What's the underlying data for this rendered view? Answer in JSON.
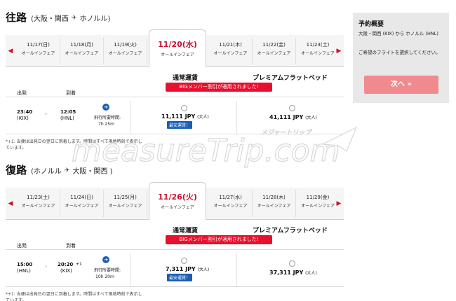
{
  "outbound": {
    "title": "往路",
    "from": "(大阪・関西",
    "to": "ホノルル)",
    "dates": [
      {
        "date": "11/17(日)",
        "sub": "オールインフェア"
      },
      {
        "date": "11/18(月)",
        "sub": "オールインフェア"
      },
      {
        "date": "11/19(火)",
        "sub": "オールインフェア"
      },
      {
        "date": "11/20(水)",
        "sub": "オールインフェア"
      },
      {
        "date": "11/21(木)",
        "sub": "オールインフェア"
      },
      {
        "date": "11/22(金)",
        "sub": "オールインフェア"
      },
      {
        "date": "11/23(土)",
        "sub": "オールインフェア"
      }
    ],
    "fare_regular": "通常運賃",
    "fare_premium": "プレミアムフラットベッド",
    "banner": "BIGメンバー割引が適用されました!",
    "label_depart": "出発",
    "label_arrive": "到着",
    "flight": {
      "dep_time": "23:40",
      "dep_code": "(KIX)",
      "arr_time": "12:05",
      "arr_code": "(HNL)",
      "duration_label": "飛行所要時間:",
      "duration": "7h 25m",
      "regular_price": "11,111 JPY",
      "regular_unit": "(大人)",
      "cheapest": "最安運賃！",
      "premium_price": "41,111 JPY",
      "premium_unit": "(大人)"
    },
    "note": "*+1: 当便は出発日の翌日に到着します。時間はすべて現地時刻で表示しています。"
  },
  "return": {
    "title": "復路",
    "from": "(ホノルル",
    "to": "大阪・関西 )",
    "dates": [
      {
        "date": "11/23(土)",
        "sub": "オールインフェア"
      },
      {
        "date": "11/24(日)",
        "sub": "オールインフェア"
      },
      {
        "date": "11/25(月)",
        "sub": "オールインフェア"
      },
      {
        "date": "11/26(火)",
        "sub": "オールインフェア"
      },
      {
        "date": "11/27(水)",
        "sub": "オールインフェア"
      },
      {
        "date": "11/28(木)",
        "sub": "オールインフェア"
      },
      {
        "date": "11/29(金)",
        "sub": "オールインフェア"
      }
    ],
    "fare_regular": "通常運賃",
    "fare_premium": "プレミアムフラットベッド",
    "banner": "BIGメンバー割引が適用されました!",
    "label_depart": "出発",
    "label_arrive": "到着",
    "flight": {
      "dep_time": "15:00",
      "dep_code": "(HNL)",
      "arr_time": "20:20",
      "arr_plus": "+1",
      "arr_code": "(KIX)",
      "duration_label": "飛行所要時間:",
      "duration": "10h 20m",
      "regular_price": "7,311 JPY",
      "regular_unit": "(大人)",
      "cheapest": "最安運賃！",
      "premium_price": "37,311 JPY",
      "premium_unit": "(大人)"
    },
    "note": "*+1: 当便は出発日の翌日に到着します。時間はすべて現地時刻で表示しています。"
  },
  "summary": {
    "title": "予約概要",
    "route": "大阪・関西 (KIX) から ホノルル (HNL)",
    "message": "ご希望のフライトを選択してください。",
    "next": "次へ »"
  },
  "watermark": {
    "text": "measureTrip.com",
    "kana": "メジャートリップ"
  },
  "colors": {
    "accent_red": "#c8102e",
    "banner_red": "#e8102e",
    "next_button": "#f08a8e",
    "cheapest_blue": "#1a5fb4"
  }
}
